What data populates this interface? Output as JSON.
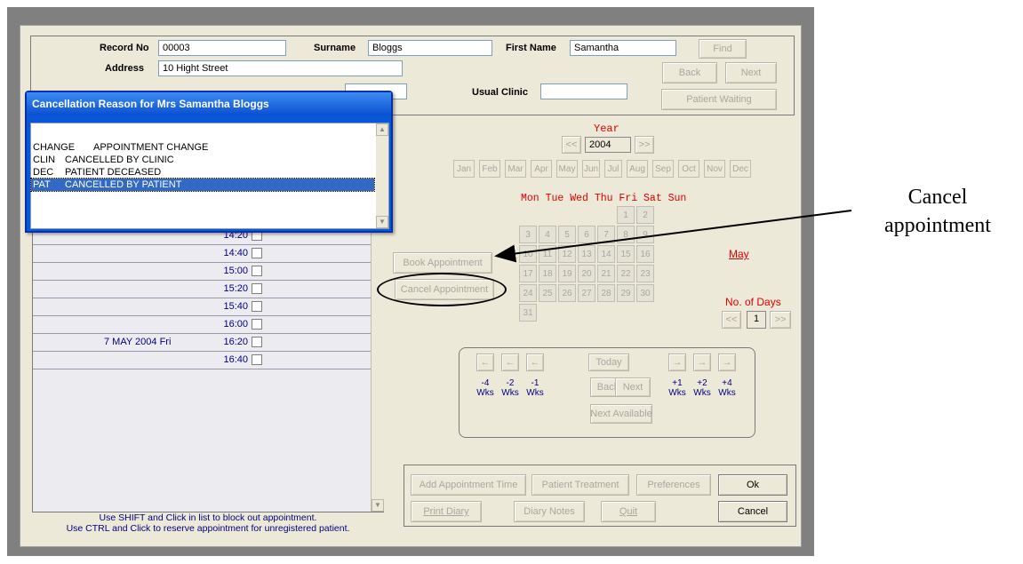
{
  "header": {
    "record_no_label": "Record No",
    "record_no_value": "00003",
    "surname_label": "Surname",
    "surname_value": "Bloggs",
    "first_name_label": "First Name",
    "first_name_value": "Samantha",
    "address_label": "Address",
    "address_value": "10 Hight Street",
    "usual_clinic_label": "Usual Clinic",
    "usual_clinic_value": "",
    "find_label": "Find",
    "back_label": "Back",
    "next_label": "Next",
    "patient_waiting_label": "Patient Waiting"
  },
  "popup": {
    "title": "Cancellation Reason for Mrs Samantha Bloggs",
    "items": [
      {
        "code": "CHANGE",
        "text": "APPOINTMENT CHANGE"
      },
      {
        "code": "CLIN",
        "text": "CANCELLED BY CLINIC"
      },
      {
        "code": "DEC",
        "text": "PATIENT DECEASED"
      },
      {
        "code": "PAT",
        "text": "CANCELLED BY PATIENT"
      }
    ]
  },
  "slots": {
    "times": [
      "14:20",
      "14:40",
      "15:00",
      "15:20",
      "15:40",
      "16:00",
      "16:20",
      "16:40"
    ],
    "date_label": "7 MAY 2004  Fri"
  },
  "hints": {
    "line1": "Use SHIFT and Click in list to block out appointment.",
    "line2": "Use CTRL and Click to reserve appointment for unregistered patient."
  },
  "calendar": {
    "year_label": "Year",
    "year_value": "2004",
    "prev_year": "<<",
    "next_year": ">>",
    "months": [
      "Jan",
      "Feb",
      "Mar",
      "Apr",
      "May",
      "Jun",
      "Jul",
      "Aug",
      "Sep",
      "Oct",
      "Nov",
      "Dec"
    ],
    "weekday_header": "Mon Tue Wed Thu Fri Sat Sun",
    "days": [
      "1",
      "2",
      "3",
      "4",
      "5",
      "6",
      "7",
      "8",
      "9",
      "10",
      "11",
      "12",
      "13",
      "14",
      "15",
      "16",
      "17",
      "18",
      "19",
      "20",
      "21",
      "22",
      "23",
      "24",
      "25",
      "26",
      "27",
      "28",
      "29",
      "30",
      "31"
    ],
    "month_name": "May",
    "no_of_days_label": "No. of Days",
    "no_of_days_value": "1",
    "prev_days": "<<",
    "next_days": ">>"
  },
  "actions": {
    "book_appointment": "Book Appointment",
    "cancel_appointment": "Cancel Appointment"
  },
  "nav": {
    "left_arrow": "←",
    "right_arrow": "→",
    "today": "Today",
    "back": "Back",
    "next": "Next",
    "next_available": "Next Available",
    "minus4": "-4",
    "minus2": "-2",
    "minus1": "-1",
    "plus1": "+1",
    "plus2": "+2",
    "plus4": "+4",
    "wks": "Wks"
  },
  "footer": {
    "add_appointment_time": "Add Appointment Time",
    "patient_treatment": "Patient Treatment",
    "preferences": "Preferences",
    "ok": "Ok",
    "print_diary": "Print Diary",
    "diary_notes": "Diary Notes",
    "quit": "Quit",
    "cancel": "Cancel"
  },
  "annotation": {
    "line1": "Cancel",
    "line2": "appointment"
  }
}
